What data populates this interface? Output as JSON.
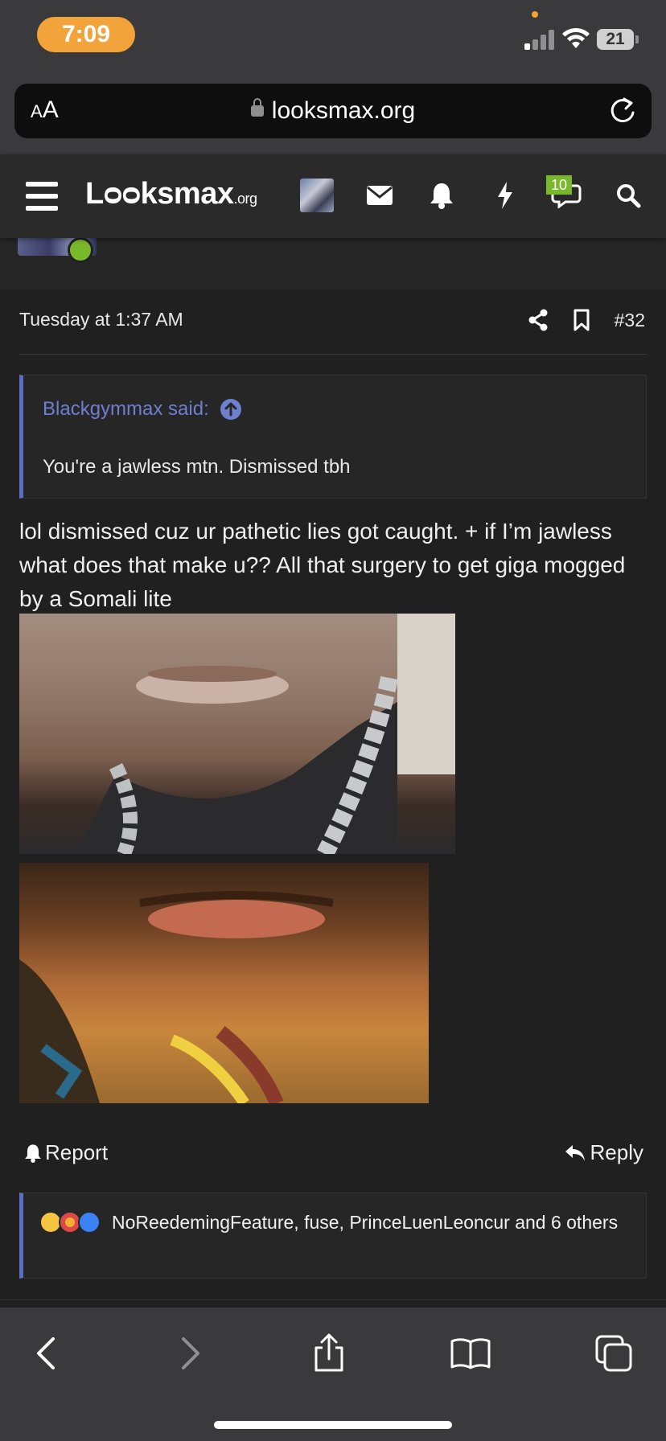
{
  "status_bar": {
    "time": "7:09",
    "battery": "21"
  },
  "browser": {
    "text_size_label_small": "A",
    "text_size_label_large": "A",
    "url": "looksmax.org"
  },
  "site_nav": {
    "logo_text": "Lᴑᴑksmax",
    "logo_suffix": ".org",
    "chat_badge_count": "10",
    "icons": [
      "menu-icon",
      "avatar",
      "mail-icon",
      "bell-icon",
      "bolt-icon",
      "chat-icon",
      "search-icon"
    ]
  },
  "post": {
    "timestamp": "Tuesday at 1:37 AM",
    "post_number": "#32",
    "quote": {
      "author_line": "Blackgymmax said:",
      "text": "You're a jawless mtn. Dismissed tbh"
    },
    "body": "lol dismissed cuz ur pathetic lies got caught. + if I’m jawless what does that make u?? All that surgery to get giga mogged by a Somali lite",
    "report_label": "Report",
    "reply_label": "Reply",
    "reactions_text": "NoReedemingFeature, fuse, PrinceLuenLeoncur and 6 others"
  },
  "colors": {
    "accent_blue": "#5c6ec4",
    "quote_link": "#6f7fd0",
    "badge_green": "#7ab82b",
    "time_pill": "#f2a33a"
  }
}
